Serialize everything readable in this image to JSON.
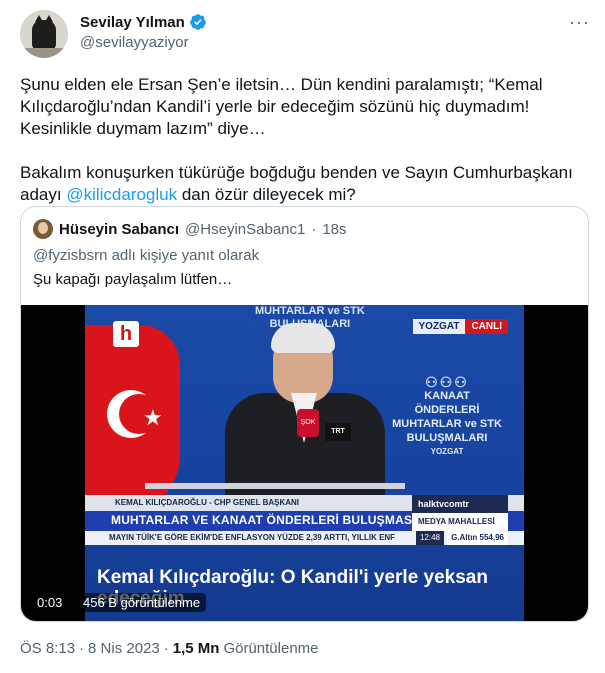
{
  "author": {
    "display_name": "Sevilay Yılman",
    "handle": "@sevilayyaziyor",
    "more_label": "···"
  },
  "tweet": {
    "paragraph1": "Şunu elden ele Ersan Şen’e iletsin… Dün kendini paralamıştı; “Kemal Kılıçdaroğlu’ndan Kandil’i yerle bir edeceğim sözünü hiç duymadım! Kesinlikle duymam lazım” diye…",
    "paragraph2_before": "Bakalım konuşurken tükürüğe boğduğu benden ve Sayın Cumhurbaşkanı adayı ",
    "mention": "@kilicdarogluk",
    "paragraph2_after": " dan özür dileyecek mi?"
  },
  "quote": {
    "name": "Hüseyin Sabancı",
    "handle": "@HseyinSabanc1",
    "separator": "·",
    "time": "18s",
    "reply_context": "@fyzisbsrn adlı kişiye yanıt olarak",
    "text": "Şu kapağı paylaşalım lütfen…"
  },
  "video": {
    "time": "0:03",
    "views": "456 B görüntülenme",
    "frame": {
      "channel_logo": "h",
      "banner_top": "MUHTARLAR ve STK\nBULUŞMALARI",
      "location": "YOZGAT",
      "live": "CANLI",
      "side_logo_line1": "KANAAT ÖNDERLERİ",
      "side_logo_line2": "MUHTARLAR ve STK",
      "side_logo_line3": "BULUŞMALARI",
      "side_logo_line4": "YOZGAT",
      "mic_label": "ŞOK",
      "trt_label": "TRT",
      "lower_name": "KEMAL KILIÇDAROĞLU - CHP GENEL BAŞKANI",
      "lower_title": "MUHTARLAR VE KANAAT ÖNDERLERİ BULUŞMASI",
      "twitter_handle": "halktvcomtr",
      "program": "MEDYA MAHALLESİ",
      "ticker": "MAYIN  TÜİK'E GÖRE EKİM'DE ENFLASYON YÜZDE 2,39 ARTTI, YILLIK ENF",
      "ticker_time": "12:48",
      "gold": "G.Altın  554,96",
      "subtitle": "Kemal Kılıçdaroğlu: O Kandil'i yerle yeksan edeceğim."
    }
  },
  "footer": {
    "time": "ÖS 8:13",
    "sep1": "·",
    "date": "8 Nis 2023",
    "sep2": "·",
    "views_count": "1,5 Mn",
    "views_label": "Görüntülenme"
  },
  "colors": {
    "verified": "#1d9bf0",
    "link": "#1d9bf0",
    "secondary_text": "#536471"
  }
}
